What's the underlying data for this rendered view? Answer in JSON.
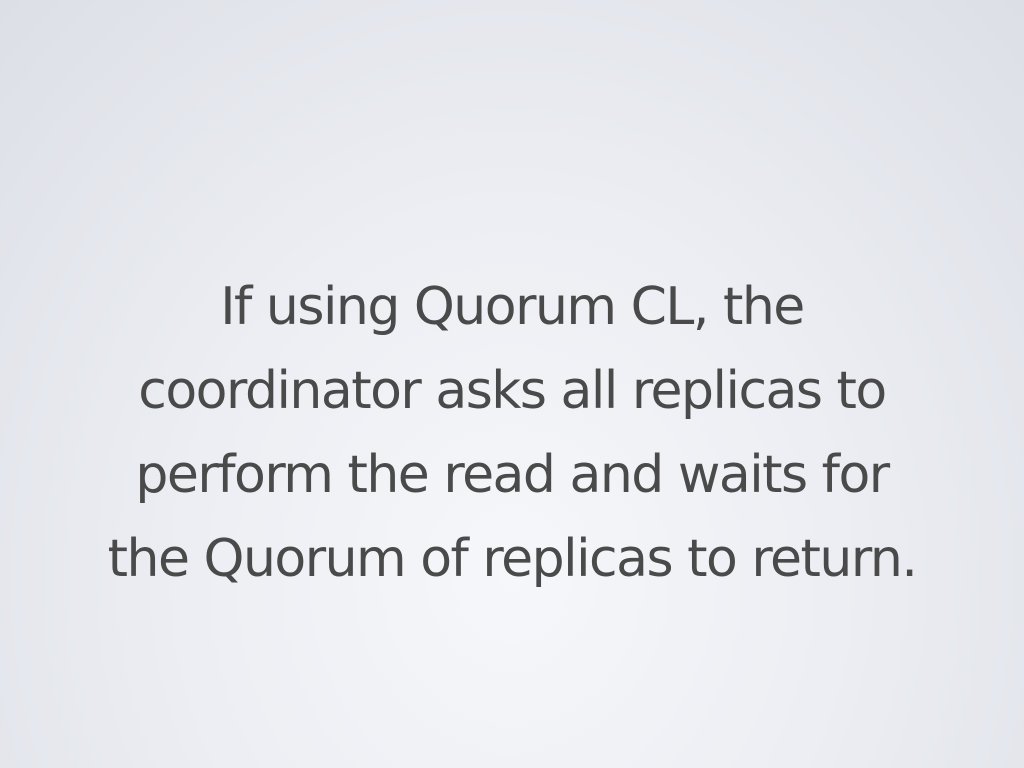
{
  "slide": {
    "lines": [
      "If using Quorum CL, the",
      "coordinator asks all replicas to",
      "perform the read and waits for",
      "the Quorum of replicas to return."
    ]
  },
  "colors": {
    "text": "#4a4a4a",
    "background": "#eceef3"
  }
}
